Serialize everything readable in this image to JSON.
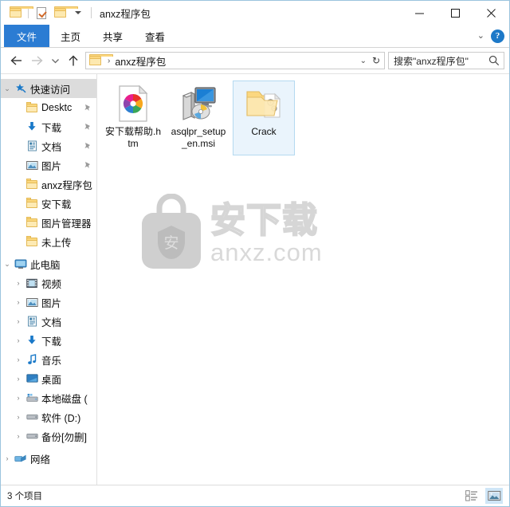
{
  "window": {
    "title": "anxz程序包",
    "quick_access_toolbar": [
      {
        "name": "folder-icon",
        "label": ""
      },
      {
        "name": "properties-icon",
        "label": ""
      },
      {
        "name": "new-folder-icon",
        "label": ""
      },
      {
        "name": "customize-qat-chevron",
        "label": ""
      }
    ],
    "controls": {
      "minimize": "—",
      "maximize": "□",
      "close": "✕"
    }
  },
  "ribbon": {
    "tabs": [
      {
        "label": "文件",
        "active": true
      },
      {
        "label": "主页",
        "active": false
      },
      {
        "label": "共享",
        "active": false
      },
      {
        "label": "查看",
        "active": false
      }
    ],
    "expand_chevron": "⌄",
    "help_label": "?"
  },
  "address": {
    "back_tooltip": "←",
    "forward_tooltip": "→",
    "recent_chevron": "⌄",
    "up_tooltip": "↑",
    "breadcrumb": [
      "anxz程序包"
    ],
    "breadcrumb_separator": "›",
    "dropdown_chevron": "⌄",
    "refresh_glyph": "↻"
  },
  "search": {
    "placeholder": "搜索\"anxz程序包\"",
    "value": "搜索\"anxz程序包\""
  },
  "sidebar": {
    "groups": [
      {
        "label": "快速访问",
        "icon": "star-pin-icon",
        "expander": "⌄",
        "selected": true,
        "items": [
          {
            "label": "Desktc",
            "icon": "folder-icon",
            "pinned": true,
            "expander": ""
          },
          {
            "label": "下载",
            "icon": "download-icon",
            "pinned": true,
            "expander": ""
          },
          {
            "label": "文档",
            "icon": "documents-icon",
            "pinned": true,
            "expander": ""
          },
          {
            "label": "图片",
            "icon": "pictures-icon",
            "pinned": true,
            "expander": ""
          },
          {
            "label": "anxz程序包",
            "icon": "folder-icon",
            "pinned": false,
            "expander": ""
          },
          {
            "label": "安下载",
            "icon": "folder-icon",
            "pinned": false,
            "expander": ""
          },
          {
            "label": "图片管理器",
            "icon": "folder-icon",
            "pinned": false,
            "expander": ""
          },
          {
            "label": "未上传",
            "icon": "folder-icon",
            "pinned": false,
            "expander": ""
          }
        ]
      },
      {
        "label": "此电脑",
        "icon": "this-pc-icon",
        "expander": "⌄",
        "selected": false,
        "items": [
          {
            "label": "视频",
            "icon": "videos-icon",
            "pinned": false,
            "expander": "›"
          },
          {
            "label": "图片",
            "icon": "pictures-icon",
            "pinned": false,
            "expander": "›"
          },
          {
            "label": "文档",
            "icon": "documents-icon",
            "pinned": false,
            "expander": "›"
          },
          {
            "label": "下载",
            "icon": "download-icon",
            "pinned": false,
            "expander": "›"
          },
          {
            "label": "音乐",
            "icon": "music-icon",
            "pinned": false,
            "expander": "›"
          },
          {
            "label": "桌面",
            "icon": "desktop-icon",
            "pinned": false,
            "expander": "›"
          },
          {
            "label": "本地磁盘 (",
            "icon": "system-drive-icon",
            "pinned": false,
            "expander": "›"
          },
          {
            "label": "软件 (D:)",
            "icon": "drive-icon",
            "pinned": false,
            "expander": "›"
          },
          {
            "label": "备份[勿删]",
            "icon": "drive-icon",
            "pinned": false,
            "expander": "›"
          }
        ]
      },
      {
        "label": "网络",
        "icon": "network-icon",
        "expander": "›",
        "selected": false,
        "items": []
      }
    ]
  },
  "files": [
    {
      "name": "安下载帮助.htm",
      "icon": "html-pinwheel-icon",
      "selected": false
    },
    {
      "name": "asqlpr_setup_en.msi",
      "icon": "msi-installer-icon",
      "selected": false
    },
    {
      "name": "Crack",
      "icon": "folder-gear-icon",
      "selected": true
    }
  ],
  "watermark": {
    "logo": "anxz-bag-icon",
    "chinese": "安下载",
    "url": "anxz.com"
  },
  "statusbar": {
    "item_count": "3 个项目",
    "views": [
      {
        "name": "details-view",
        "active": false
      },
      {
        "name": "large-icons-view",
        "active": true
      }
    ]
  },
  "colors": {
    "file_tab": "#2b7cd3",
    "selection": "#eaf4fc",
    "selection_border": "#b4d9f0",
    "window_border": "#9bc4dd",
    "tree_selected": "#dcdcdc"
  }
}
